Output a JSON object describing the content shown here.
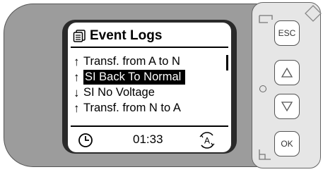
{
  "screen": {
    "title": "Event Logs",
    "title_icon": "event-log-icon",
    "events": [
      {
        "arrow": "↑",
        "label": "Transf. from A to N",
        "selected": false
      },
      {
        "arrow": "↑",
        "label": "SI Back To Normal",
        "selected": true
      },
      {
        "arrow": "↓",
        "label": "SI No Voltage",
        "selected": false
      },
      {
        "arrow": "↑",
        "label": "Transf. from N to A",
        "selected": false
      }
    ],
    "footer": {
      "time": "01:33",
      "clock_icon": "clock-icon",
      "mode_icon": "auto-mode-icon",
      "mode_letter": "A"
    }
  },
  "buttons": {
    "esc_label": "ESC",
    "up_icon": "up-triangle-icon",
    "down_icon": "down-triangle-icon",
    "ok_label": "OK"
  },
  "colors": {
    "housing": "#9c9c9c",
    "bezel": "#2a2a2a",
    "panel": "#e6e6e6",
    "selection_bg": "#000000",
    "selection_fg": "#ffffff"
  }
}
